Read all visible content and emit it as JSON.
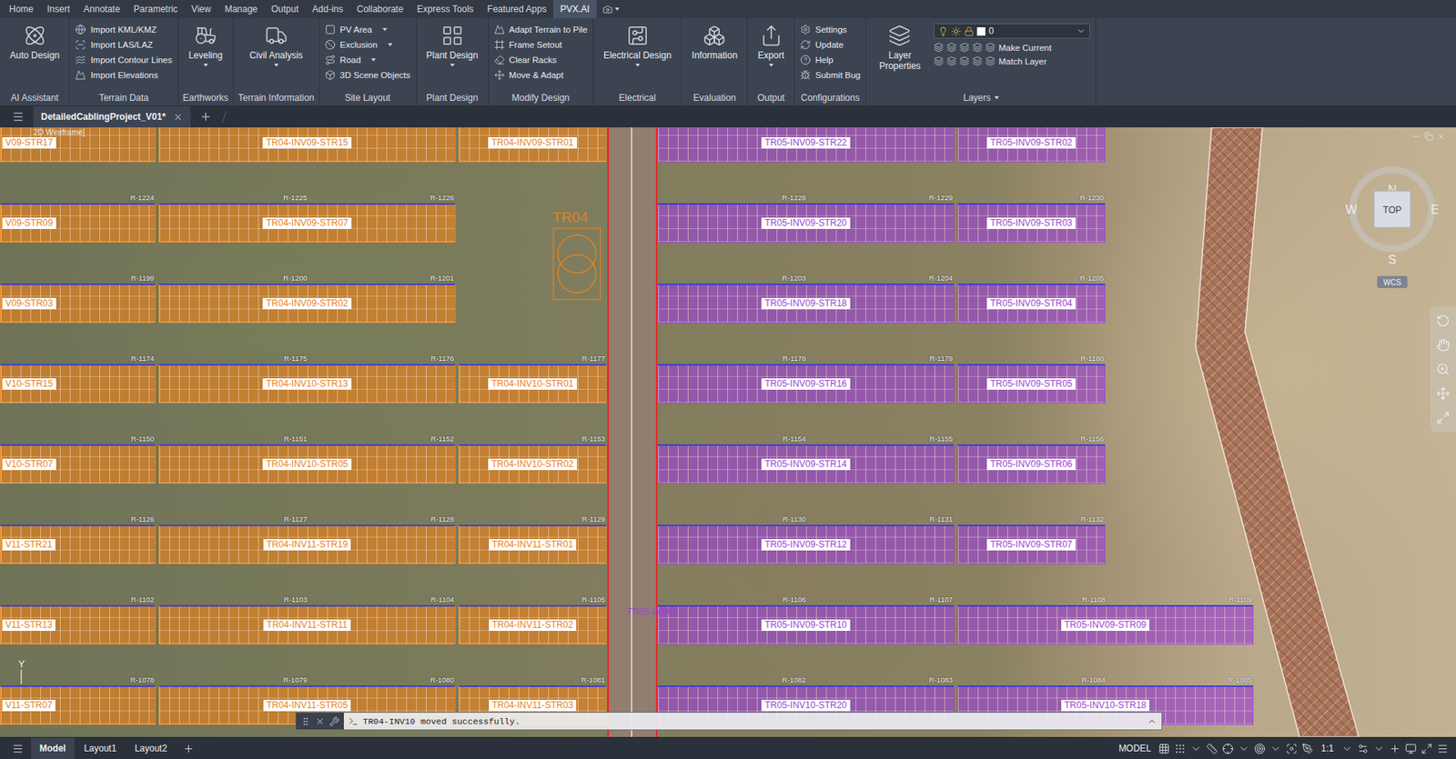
{
  "menu": {
    "tabs": [
      {
        "label": "Home",
        "selected": false
      },
      {
        "label": "Insert",
        "selected": false
      },
      {
        "label": "Annotate",
        "selected": false
      },
      {
        "label": "Parametric",
        "selected": false
      },
      {
        "label": "View",
        "selected": false
      },
      {
        "label": "Manage",
        "selected": false
      },
      {
        "label": "Output",
        "selected": false
      },
      {
        "label": "Add-ins",
        "selected": false
      },
      {
        "label": "Collaborate",
        "selected": false
      },
      {
        "label": "Express Tools",
        "selected": false
      },
      {
        "label": "Featured Apps",
        "selected": false
      },
      {
        "label": "PVX.AI",
        "selected": true
      }
    ]
  },
  "ribbon": {
    "panels": [
      {
        "title": "AI Assistant",
        "kind": "large",
        "items": [
          {
            "label": "Auto Design",
            "dropdown": false
          }
        ]
      },
      {
        "title": "Terrain Data",
        "kind": "list",
        "items": [
          {
            "label": "Import KML/KMZ",
            "dropdown": false
          },
          {
            "label": "Import LAS/LAZ",
            "dropdown": false
          },
          {
            "label": "Import Contour Lines",
            "dropdown": false
          },
          {
            "label": "Import Elevations",
            "dropdown": false
          }
        ]
      },
      {
        "title": "Earthworks",
        "kind": "large",
        "items": [
          {
            "label": "Leveling",
            "dropdown": true
          }
        ]
      },
      {
        "title": "Terrain Information",
        "kind": "large",
        "items": [
          {
            "label": "Civil Analysis",
            "dropdown": true
          }
        ]
      },
      {
        "title": "Site Layout",
        "kind": "list",
        "items": [
          {
            "label": "PV Area",
            "dropdown": true
          },
          {
            "label": "Exclusion",
            "dropdown": true
          },
          {
            "label": "Road",
            "dropdown": true
          },
          {
            "label": "3D Scene Objects",
            "dropdown": false
          }
        ]
      },
      {
        "title": "Plant Design",
        "kind": "large",
        "items": [
          {
            "label": "Plant Design",
            "dropdown": true
          }
        ]
      },
      {
        "title": "Modify Design",
        "kind": "list",
        "items": [
          {
            "label": "Adapt Terrain to Pile",
            "dropdown": false
          },
          {
            "label": "Frame Setout",
            "dropdown": false
          },
          {
            "label": "Clear Racks",
            "dropdown": false
          },
          {
            "label": "Move & Adapt",
            "dropdown": false
          }
        ]
      },
      {
        "title": "Electrical",
        "kind": "large",
        "items": [
          {
            "label": "Electrical Design",
            "dropdown": true
          }
        ]
      },
      {
        "title": "Evaluation",
        "kind": "large",
        "items": [
          {
            "label": "Information",
            "dropdown": false
          }
        ]
      },
      {
        "title": "Output",
        "kind": "large",
        "items": [
          {
            "label": "Export",
            "dropdown": true
          }
        ]
      },
      {
        "title": "Configurations",
        "kind": "list",
        "items": [
          {
            "label": "Settings",
            "dropdown": false
          },
          {
            "label": "Update",
            "dropdown": false
          },
          {
            "label": "Help",
            "dropdown": false
          },
          {
            "label": "Submit Bug",
            "dropdown": false
          }
        ]
      }
    ],
    "layers": {
      "title": "Layers",
      "title_dropdown": true,
      "button": "Layer Properties",
      "current_layer": "0",
      "actions": [
        "Make Current",
        "Match Layer"
      ]
    }
  },
  "document_tabs": [
    {
      "label": "DetailedCablingProject_V01*",
      "selected": true
    }
  ],
  "canvas": {
    "viewport_label": "2D Wireframe]",
    "rows": [
      {
        "left": [
          {
            "label": "V09-STR17",
            "kind": "cut",
            "color": "#e8821e",
            "rlabels": []
          },
          {
            "label": "TR04-INV09-STR15",
            "kind": "long",
            "color": "#e8821e",
            "rlabels": []
          },
          {
            "label": "TR04-INV09-STR01",
            "kind": "short",
            "color": "#e8821e",
            "rlabels": []
          }
        ],
        "right": [
          {
            "label": "TR05-INV09-STR22",
            "kind": "long",
            "color": "#9b45d0",
            "rlabels": []
          },
          {
            "label": "TR05-INV09-STR02",
            "kind": "short",
            "color": "#9b45d0",
            "rlabels": []
          }
        ]
      },
      {
        "left": [
          {
            "label": "V09-STR09",
            "kind": "cut",
            "color": "#e8821e",
            "rlabels": [
              "R-1224"
            ]
          },
          {
            "label": "TR04-INV09-STR07",
            "kind": "long",
            "color": "#e8821e",
            "rlabels": [
              "R-1225",
              "R-1226"
            ]
          }
        ],
        "right": [
          {
            "label": "TR05-INV09-STR20",
            "kind": "long",
            "color": "#9b45d0",
            "rlabels": [
              "R-1228",
              "R-1229"
            ]
          },
          {
            "label": "TR05-INV09-STR03",
            "kind": "short",
            "color": "#9b45d0",
            "rlabels": [
              "R-1230"
            ]
          }
        ]
      },
      {
        "left": [
          {
            "label": "V09-STR03",
            "kind": "cut",
            "color": "#e8821e",
            "rlabels": [
              "R-1199"
            ]
          },
          {
            "label": "TR04-INV09-STR02",
            "kind": "long",
            "color": "#e8821e",
            "rlabels": [
              "R-1200",
              "R-1201"
            ]
          }
        ],
        "right": [
          {
            "label": "TR05-INV09-STR18",
            "kind": "long",
            "color": "#9b45d0",
            "rlabels": [
              "R-1203",
              "R-1204"
            ]
          },
          {
            "label": "TR05-INV09-STR04",
            "kind": "short",
            "color": "#9b45d0",
            "rlabels": [
              "R-1205"
            ]
          }
        ]
      },
      {
        "left": [
          {
            "label": "V10-STR15",
            "kind": "cut",
            "color": "#e8821e",
            "rlabels": [
              "R-1174"
            ]
          },
          {
            "label": "TR04-INV10-STR13",
            "kind": "long",
            "color": "#e8821e",
            "rlabels": [
              "R-1175",
              "R-1176"
            ]
          },
          {
            "label": "TR04-INV10-STR01",
            "kind": "short",
            "color": "#e8821e",
            "rlabels": [
              "R-1177"
            ]
          }
        ],
        "right": [
          {
            "label": "TR05-INV09-STR16",
            "kind": "long",
            "color": "#9b45d0",
            "rlabels": [
              "R-1178",
              "R-1179"
            ]
          },
          {
            "label": "TR05-INV09-STR05",
            "kind": "short",
            "color": "#9b45d0",
            "rlabels": [
              "R-1180"
            ]
          }
        ]
      },
      {
        "left": [
          {
            "label": "V10-STR07",
            "kind": "cut",
            "color": "#e8821e",
            "rlabels": [
              "R-1150"
            ]
          },
          {
            "label": "TR04-INV10-STR05",
            "kind": "long",
            "color": "#e8821e",
            "rlabels": [
              "R-1151",
              "R-1152"
            ]
          },
          {
            "label": "TR04-INV10-STR02",
            "kind": "short",
            "color": "#e8821e",
            "rlabels": [
              "R-1153"
            ]
          }
        ],
        "right": [
          {
            "label": "TR05-INV09-STR14",
            "kind": "long",
            "color": "#9b45d0",
            "rlabels": [
              "R-1154",
              "R-1155"
            ]
          },
          {
            "label": "TR05-INV09-STR06",
            "kind": "short",
            "color": "#9b45d0",
            "rlabels": [
              "R-1156"
            ]
          }
        ]
      },
      {
        "left": [
          {
            "label": "V11-STR21",
            "kind": "cut",
            "color": "#e8821e",
            "rlabels": [
              "R-1126"
            ]
          },
          {
            "label": "TR04-INV11-STR19",
            "kind": "long",
            "color": "#e8821e",
            "rlabels": [
              "R-1127",
              "R-1128"
            ]
          },
          {
            "label": "TR04-INV11-STR01",
            "kind": "short",
            "color": "#e8821e",
            "rlabels": [
              "R-1129"
            ]
          }
        ],
        "right": [
          {
            "label": "TR05-INV09-STR12",
            "kind": "long",
            "color": "#9b45d0",
            "rlabels": [
              "R-1130",
              "R-1131"
            ]
          },
          {
            "label": "TR05-INV09-STR07",
            "kind": "short",
            "color": "#9b45d0",
            "rlabels": [
              "R-1132"
            ]
          }
        ]
      },
      {
        "left": [
          {
            "label": "V11-STR13",
            "kind": "cut",
            "color": "#e8821e",
            "rlabels": [
              "R-1102"
            ]
          },
          {
            "label": "TR04-INV11-STR11",
            "kind": "long",
            "color": "#e8821e",
            "rlabels": [
              "R-1103",
              "R-1104"
            ]
          },
          {
            "label": "TR04-INV11-STR02",
            "kind": "short",
            "color": "#e8821e",
            "rlabels": [
              "R-1105"
            ]
          }
        ],
        "right": [
          {
            "label": "TR05-INV09-STR10",
            "kind": "long",
            "color": "#9b45d0",
            "rlabels": [
              "R-1106",
              "R-1107"
            ]
          },
          {
            "label": "TR05-INV09-STR09",
            "kind": "wide",
            "color": "#9b45d0",
            "rlabels": [
              "R-1108",
              "R-1109"
            ]
          }
        ]
      },
      {
        "left": [
          {
            "label": "V11-STR07",
            "kind": "cut",
            "color": "#e8821e",
            "rlabels": [
              "R-1078"
            ]
          },
          {
            "label": "TR04-INV11-STR05",
            "kind": "long",
            "color": "#e8821e",
            "rlabels": [
              "R-1079",
              "R-1080"
            ]
          },
          {
            "label": "TR04-INV11-STR03",
            "kind": "short",
            "color": "#e8821e",
            "rlabels": [
              "R-1081"
            ]
          }
        ],
        "right": [
          {
            "label": "TR05-INV10-STR20",
            "kind": "long",
            "color": "#9b45d0",
            "rlabels": [
              "R-1082",
              "R-1083"
            ]
          },
          {
            "label": "TR05-INV10-STR18",
            "kind": "wide",
            "color": "#9b45d0",
            "rlabels": [
              "R-1084",
              "R-1085"
            ]
          }
        ]
      }
    ],
    "transformer": {
      "label": "TR04",
      "color": "#e8821e"
    },
    "inverter_label": {
      "label": "TR05-INV09",
      "color": "#9b45d0"
    },
    "compass": {
      "north": "N",
      "south": "S",
      "east": "E",
      "west": "W",
      "view": "TOP",
      "ucs": "WCS"
    },
    "ucs_icon": {
      "axis": "Y"
    },
    "command_line": {
      "message": "TR04-INV10 moved successfully."
    }
  },
  "status_bar": {
    "layouts": [
      {
        "label": "Model",
        "selected": true
      },
      {
        "label": "Layout1",
        "selected": false
      },
      {
        "label": "Layout2",
        "selected": false
      }
    ],
    "space": "MODEL",
    "scale": "1:1"
  }
}
